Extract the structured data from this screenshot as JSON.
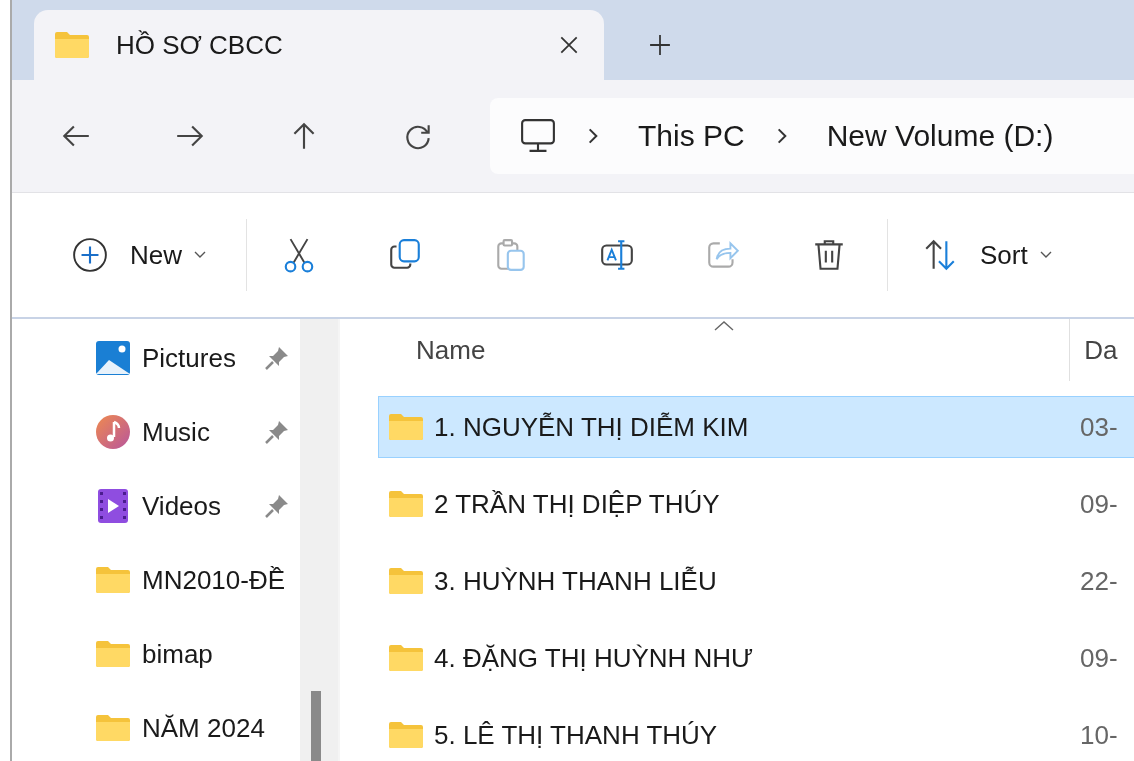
{
  "tabs": [
    {
      "title": "HỒ SƠ CBCC",
      "selected": true
    }
  ],
  "address": {
    "crumbs": [
      "This PC",
      "New Volume (D:)"
    ]
  },
  "toolbar": [
    {
      "kind": "new",
      "label": "New",
      "disabled": false
    },
    {
      "kind": "cut",
      "disabled": false
    },
    {
      "kind": "copy",
      "disabled": false
    },
    {
      "kind": "paste",
      "disabled": true
    },
    {
      "kind": "rename",
      "disabled": false
    },
    {
      "kind": "share",
      "disabled": true
    },
    {
      "kind": "delete",
      "disabled": false
    },
    {
      "kind": "sort",
      "label": "Sort",
      "disabled": false
    }
  ],
  "sidebar": {
    "items": [
      {
        "kind": "pictures",
        "label": "Pictures",
        "pinned": true
      },
      {
        "kind": "music",
        "label": "Music",
        "pinned": true
      },
      {
        "kind": "videos",
        "label": "Videos",
        "pinned": true
      },
      {
        "kind": "folder",
        "label": "MN2010-ĐỀ",
        "pinned": false
      },
      {
        "kind": "folder",
        "label": "bimap",
        "pinned": false
      },
      {
        "kind": "folder",
        "label": "NĂM 2024",
        "pinned": false
      }
    ]
  },
  "file_list": {
    "columns": [
      {
        "label": "Name",
        "sorted": true
      },
      {
        "label": "Da",
        "sorted": false
      }
    ],
    "rows": [
      {
        "name": "1. NGUYỄN THỊ DIỄM KIM",
        "date": "03-",
        "selected": true
      },
      {
        "name": "2 TRẦN THỊ  DIỆP THÚY",
        "date": "09-",
        "selected": false
      },
      {
        "name": "3. HUỲNH THANH LIỄU",
        "date": "22-",
        "selected": false
      },
      {
        "name": "4. ĐẶNG THỊ HUỲNH NHƯ",
        "date": "09-",
        "selected": false
      },
      {
        "name": "5. LÊ THỊ THANH THÚY",
        "date": "10-",
        "selected": false
      }
    ]
  }
}
